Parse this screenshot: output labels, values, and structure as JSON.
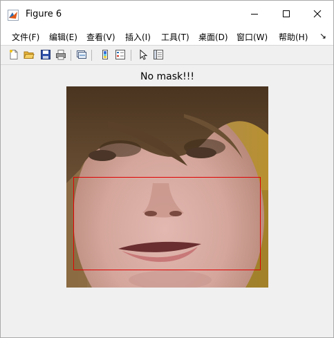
{
  "window": {
    "title": "Figure 6"
  },
  "menu": [
    {
      "label": "文件(F)"
    },
    {
      "label": "编辑(E)"
    },
    {
      "label": "查看(V)"
    },
    {
      "label": "插入(I)"
    },
    {
      "label": "工具(T)"
    },
    {
      "label": "桌面(D)"
    },
    {
      "label": "窗口(W)"
    },
    {
      "label": "帮助(H)"
    }
  ],
  "menu_overflow": "↘",
  "toolbar_icons": [
    "new-figure-icon",
    "open-file-icon",
    "save-icon",
    "print-icon",
    "link-plot-icon",
    "colorbar-icon",
    "legend-icon",
    "pointer-icon",
    "property-editor-icon"
  ],
  "figure": {
    "title": "No mask!!!",
    "box_color": "#e00000"
  }
}
